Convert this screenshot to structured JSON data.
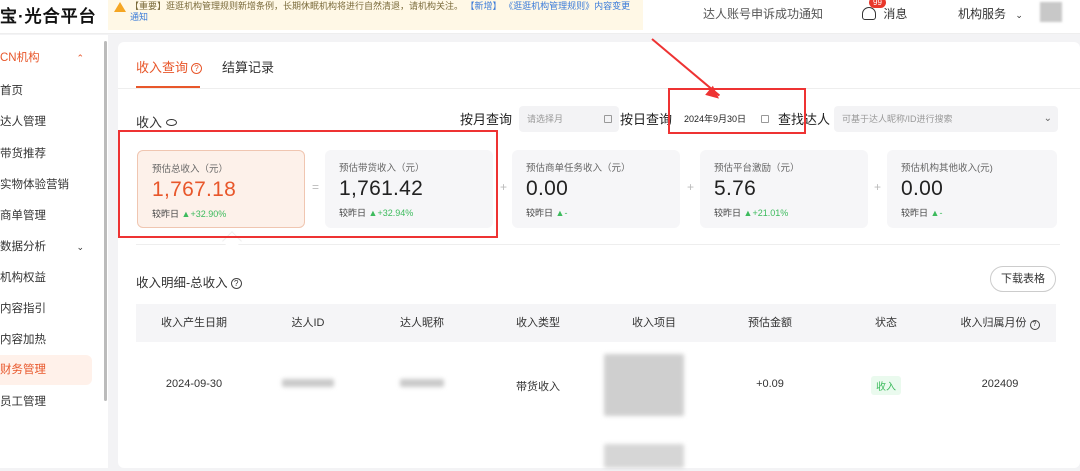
{
  "header": {
    "logo": "宝·光合平台",
    "notice": {
      "tag": "【重要】",
      "text": "逛逛机构管理规则新增条例，长期休眠机构将进行自然清退，请机构关注。",
      "link_new": "【新增】",
      "link_text": "《逛逛机构管理规则》内容变更通知"
    },
    "appeal_notice": "达人账号申诉成功通知",
    "messages_label": "消息",
    "messages_badge": "99",
    "org_service": "机构服务"
  },
  "sidebar": {
    "group_label": "CN机构",
    "items": [
      {
        "label": "首页"
      },
      {
        "label": "达人管理"
      },
      {
        "label": "带货推荐"
      },
      {
        "label": "实物体验营销"
      },
      {
        "label": "商单管理"
      },
      {
        "label": "数据分析"
      },
      {
        "label": "机构权益"
      },
      {
        "label": "内容指引"
      },
      {
        "label": "内容加热"
      },
      {
        "label": "财务管理"
      },
      {
        "label": "员工管理"
      }
    ]
  },
  "tabs": [
    {
      "label": "收入查询"
    },
    {
      "label": "结算记录"
    }
  ],
  "income": {
    "title": "收入",
    "query_month_label": "按月查询",
    "month_placeholder": "请选择月",
    "query_day_label": "按日查询",
    "day_value": "2024年9月30日",
    "search_talent_label": "查找达人",
    "search_placeholder": "可基于达人昵称/ID进行搜索"
  },
  "cards": [
    {
      "label": "预估总收入（元）",
      "value": "1,767.18",
      "cmp_label": "较昨日",
      "cmp_value": "▲+32.90%"
    },
    {
      "label": "预估带货收入（元）",
      "value": "1,761.42",
      "cmp_label": "较昨日",
      "cmp_value": "▲+32.94%"
    },
    {
      "label": "预估商单任务收入（元）",
      "value": "0.00",
      "cmp_label": "较昨日",
      "cmp_value": "▲-"
    },
    {
      "label": "预估平台激励（元）",
      "value": "5.76",
      "cmp_label": "较昨日",
      "cmp_value": "▲+21.01%"
    },
    {
      "label": "预估机构其他收入(元)",
      "value": "0.00",
      "cmp_label": "较昨日",
      "cmp_value": "▲-"
    }
  ],
  "operators": [
    "=",
    "+",
    "+",
    "+"
  ],
  "detail": {
    "title": "收入明细-总收入",
    "download_button": "下载表格",
    "columns": [
      "收入产生日期",
      "达人ID",
      "达人昵称",
      "收入类型",
      "收入项目",
      "预估金额",
      "状态",
      "收入归属月份"
    ],
    "rows": [
      {
        "date": "2024-09-30",
        "type": "带货收入",
        "amount": "+0.09",
        "status": "收入",
        "month": "202409"
      }
    ]
  },
  "colors": {
    "accent": "#e8572b",
    "up": "#3dbb5d",
    "annotation": "#e33333"
  }
}
